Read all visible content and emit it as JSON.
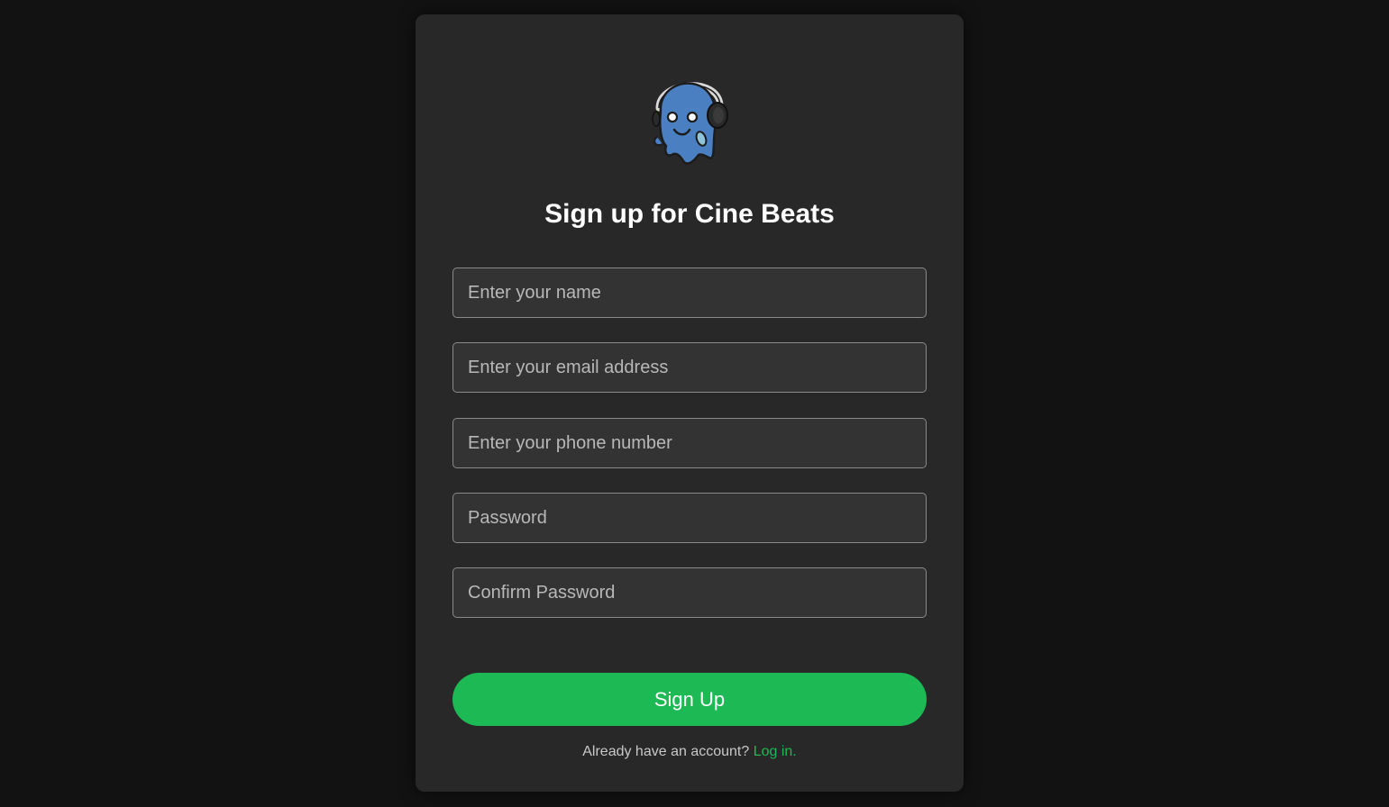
{
  "title": "Sign up for Cine Beats",
  "logo": {
    "icon": "ghost-headphones-icon"
  },
  "fields": {
    "name": {
      "placeholder": "Enter your name",
      "value": ""
    },
    "email": {
      "placeholder": "Enter your email address",
      "value": ""
    },
    "phone": {
      "placeholder": "Enter your phone number",
      "value": ""
    },
    "password": {
      "placeholder": "Password",
      "value": ""
    },
    "confirm_password": {
      "placeholder": "Confirm Password",
      "value": ""
    }
  },
  "submit_label": "Sign Up",
  "footer": {
    "prompt": "Already have an account?",
    "login_link": "Log in",
    "trailing": "."
  },
  "colors": {
    "background": "#121212",
    "card": "#282828",
    "accent": "#1db954",
    "field": "#333333"
  }
}
